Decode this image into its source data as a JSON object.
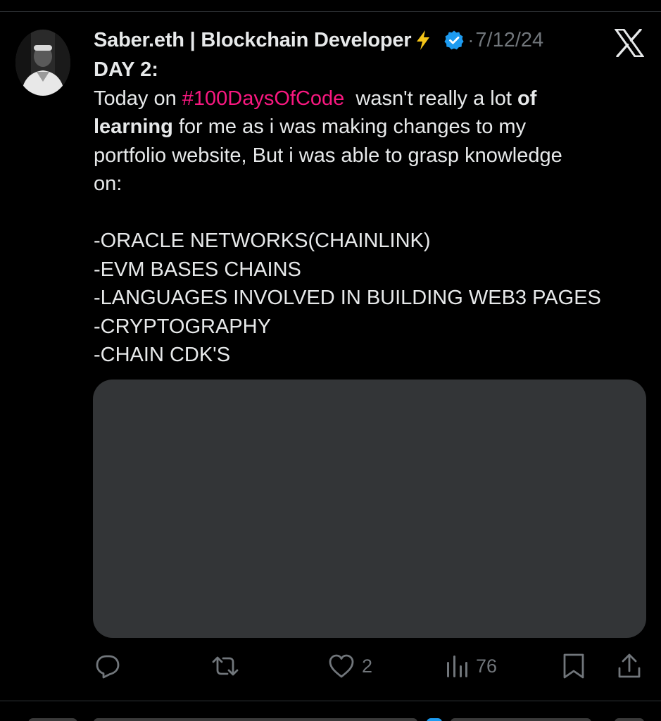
{
  "tweet": {
    "display_name": "Saber.eth | Blockchain Developer",
    "separator": "·",
    "date": "7/12/24",
    "body": {
      "title": "DAY 2:",
      "line1_pre": "Today on ",
      "hashtag": "#100DaysOfCode",
      "line1_post": "  wasn't really a lot ",
      "bold_phrase_1": "of",
      "bold_phrase_2": "learning",
      "line2_rest": " for me as i was making changes to my",
      "line3": "portfolio website, But i was able to grasp knowledge",
      "line4": "on:",
      "list": [
        "-ORACLE NETWORKS(CHAINLINK)",
        "-EVM BASES CHAINS",
        "-LANGUAGES INVOLVED IN BUILDING WEB3 PAGES",
        "-CRYPTOGRAPHY",
        "-CHAIN CDK'S"
      ]
    },
    "actions": {
      "reply_count": "",
      "retweet_count": "",
      "like_count": "2",
      "views_count": "76"
    },
    "icons": {
      "lightning": "lightning-icon",
      "verified": "verified-badge-icon",
      "x_logo": "x-logo-icon",
      "reply": "reply-icon",
      "retweet": "retweet-icon",
      "like": "heart-icon",
      "views": "views-chart-icon",
      "bookmark": "bookmark-icon",
      "share": "share-icon"
    }
  },
  "colors": {
    "background": "#000000",
    "text": "#e7e9ea",
    "muted": "#71767b",
    "hashtag": "#f91880",
    "verified": "#1d9bf0",
    "lightning": "#f5c518",
    "media_placeholder": "#333537"
  }
}
